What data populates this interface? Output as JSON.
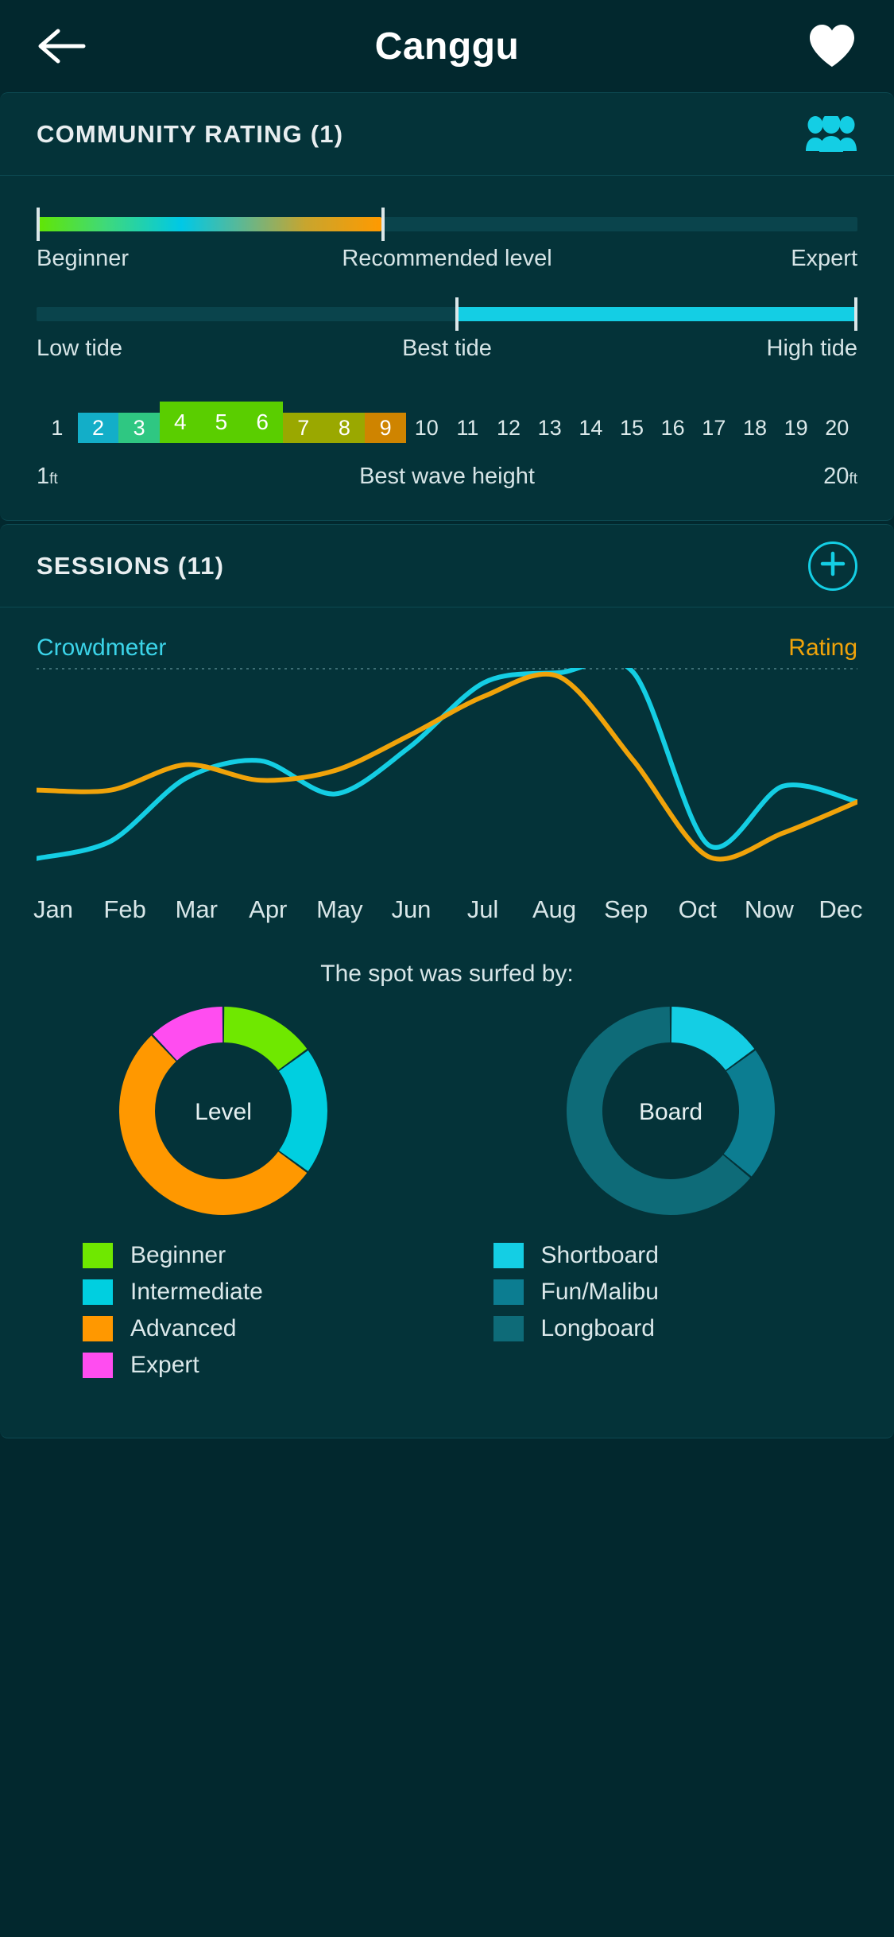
{
  "header": {
    "title": "Canggu",
    "back_icon": "arrow-left-icon",
    "favorite_icon": "heart-filled-icon"
  },
  "community": {
    "title": "COMMUNITY RATING (1)",
    "icon": "people-group-icon",
    "skill": {
      "left_label": "Beginner",
      "mid_label": "Recommended level",
      "right_label": "Expert",
      "fill_percent": 42
    },
    "tide": {
      "left_label": "Low tide",
      "mid_label": "Best tide",
      "right_label": "High tide",
      "start_percent": 51,
      "end_percent": 100
    },
    "wave": {
      "caption": "Best wave height",
      "min_label": "1",
      "min_unit": "ft",
      "max_label": "20",
      "max_unit": "ft",
      "ticks": [
        "1",
        "2",
        "3",
        "4",
        "5",
        "6",
        "7",
        "8",
        "9",
        "10",
        "11",
        "12",
        "13",
        "14",
        "15",
        "16",
        "17",
        "18",
        "19",
        "20"
      ],
      "highlight": [
        {
          "value": "2",
          "color": "#13aec8",
          "tall": false
        },
        {
          "value": "3",
          "color": "#2fc782",
          "tall": false
        },
        {
          "value": "4",
          "color": "#5ace00",
          "tall": true
        },
        {
          "value": "5",
          "color": "#5ace00",
          "tall": true
        },
        {
          "value": "6",
          "color": "#5ace00",
          "tall": true
        },
        {
          "value": "7",
          "color": "#9aa800",
          "tall": false
        },
        {
          "value": "8",
          "color": "#9aa800",
          "tall": false
        },
        {
          "value": "9",
          "color": "#cf8400",
          "tall": false
        }
      ]
    }
  },
  "sessions": {
    "title": "SESSIONS (11)",
    "add_icon": "plus-circle-icon",
    "surfed_by_label": "The spot was surfed by:",
    "chart_data": [
      {
        "type": "line",
        "title": "",
        "xlabel": "",
        "ylabel": "",
        "grid": false,
        "legend_position": "top",
        "categories": [
          "Jan",
          "Feb",
          "Mar",
          "Apr",
          "May",
          "Jun",
          "Jul",
          "Aug",
          "Sep",
          "Oct",
          "Now",
          "Dec"
        ],
        "ylim": [
          0,
          100
        ],
        "series": [
          {
            "name": "Crowdmeter",
            "color": "#14CEE4",
            "values": [
              5,
              14,
              46,
              55,
              38,
              62,
              95,
              100,
              100,
              12,
              42,
              34
            ]
          },
          {
            "name": "Rating",
            "color": "#F0A30A",
            "values": [
              40,
              40,
              53,
              45,
              50,
              68,
              88,
              98,
              55,
              6,
              18,
              34
            ]
          }
        ]
      },
      {
        "type": "pie",
        "title": "Level",
        "labels": [
          "Beginner",
          "Intermediate",
          "Advanced",
          "Expert"
        ],
        "values": [
          15,
          20,
          53,
          12
        ],
        "colors": [
          "#6FE800",
          "#00CFE0",
          "#FF9800",
          "#FF4DF0"
        ],
        "legend_position": "bottom"
      },
      {
        "type": "pie",
        "title": "Board",
        "labels": [
          "Shortboard",
          "Fun/Malibu",
          "Longboard"
        ],
        "values": [
          15,
          21,
          64
        ],
        "colors": [
          "#14CEE4",
          "#0C7D91",
          "#0E6B78"
        ],
        "legend_position": "bottom"
      }
    ],
    "level_legend": [
      {
        "label": "Beginner",
        "color": "#6FE800"
      },
      {
        "label": "Intermediate",
        "color": "#00CFE0"
      },
      {
        "label": "Advanced",
        "color": "#FF9800"
      },
      {
        "label": "Expert",
        "color": "#FF4DF0"
      }
    ],
    "board_legend": [
      {
        "label": "Shortboard",
        "color": "#14CEE4"
      },
      {
        "label": "Fun/Malibu",
        "color": "#0C7D91"
      },
      {
        "label": "Longboard",
        "color": "#0E6B78"
      }
    ]
  },
  "colors": {
    "background": "#02282e",
    "card": "#043339",
    "accent_cyan": "#14CEE4",
    "accent_orange": "#F0A30A",
    "text_primary": "#e8eef0"
  }
}
